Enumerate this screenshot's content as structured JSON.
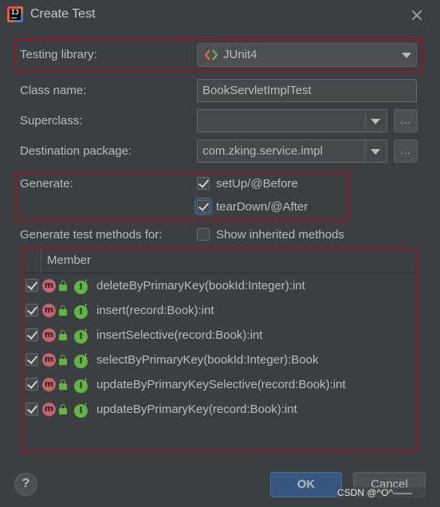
{
  "window": {
    "title": "Create Test"
  },
  "form": {
    "testing_library_label": "Testing library:",
    "testing_library_value": "JUnit4",
    "class_name_label": "Class name:",
    "class_name_value": "BookServletImplTest",
    "superclass_label": "Superclass:",
    "superclass_value": "",
    "destination_label": "Destination package:",
    "destination_value": "com.zking.service.impl",
    "browse_label": "...",
    "generate_label": "Generate:",
    "generate_options": [
      {
        "label": "setUp/@Before",
        "checked": true
      },
      {
        "label": "tearDown/@After",
        "checked": true
      }
    ],
    "methods_for_label": "Generate test methods for:",
    "show_inherited_label": "Show inherited methods",
    "show_inherited_checked": false
  },
  "table": {
    "header": "Member",
    "rows": [
      {
        "text": "deleteByPrimaryKey(bookId:Integer):int",
        "checked": true
      },
      {
        "text": "insert(record:Book):int",
        "checked": true
      },
      {
        "text": "insertSelective(record:Book):int",
        "checked": true
      },
      {
        "text": "selectByPrimaryKey(bookId:Integer):Book",
        "checked": true
      },
      {
        "text": "updateByPrimaryKeySelective(record:Book):int",
        "checked": true
      },
      {
        "text": "updateByPrimaryKey(record:Book):int",
        "checked": true
      }
    ]
  },
  "buttons": {
    "help": "?",
    "ok": "OK",
    "cancel": "Cancel"
  },
  "watermark": "CSDN @^O^——",
  "colors": {
    "background": "#3c3f41",
    "annotation": "#8b1c2b",
    "ok": "#365880",
    "method_icon": "#c2666e",
    "green": "#62b543"
  },
  "icons": [
    "app-icon",
    "close-icon",
    "junit-icon",
    "chevron-down-icon",
    "method-icon",
    "lock-icon",
    "implements-icon",
    "help-icon"
  ]
}
